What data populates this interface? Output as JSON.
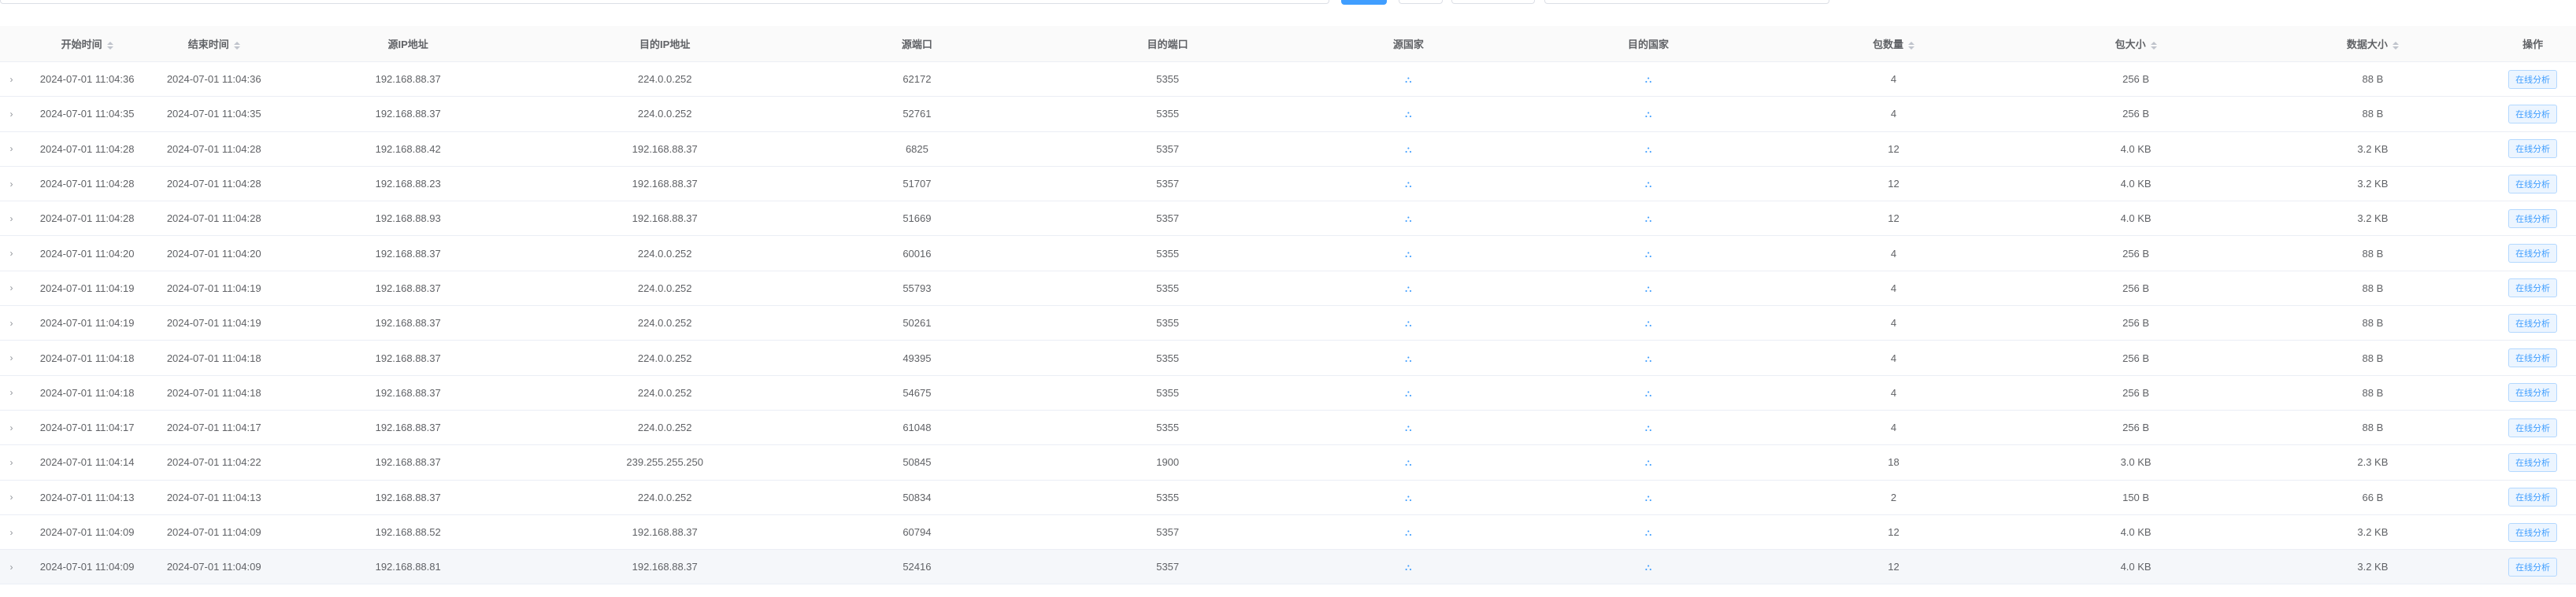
{
  "columns": {
    "start_time": "开始时间",
    "end_time": "结束时间",
    "src_ip": "源IP地址",
    "dst_ip": "目的IP地址",
    "src_port": "源端口",
    "dst_port": "目的端口",
    "src_country": "源国家",
    "dst_country": "目的国家",
    "packets": "包数量",
    "packet_size": "包大小",
    "data_size": "数据大小",
    "action": "操作"
  },
  "action_label": "在线分析",
  "icons": {
    "expand": "chevron-right-icon",
    "country": "network-flag-icon",
    "sort": "sort-caret-icon"
  },
  "colors": {
    "accent": "#409eff",
    "header_bg": "#fafafa",
    "border": "#ebeef5"
  },
  "rows": [
    {
      "start": "2024-07-01 11:04:36",
      "end": "2024-07-01 11:04:36",
      "src_ip": "192.168.88.37",
      "dst_ip": "224.0.0.252",
      "src_port": "62172",
      "dst_port": "5355",
      "packets": "4",
      "psize": "256 B",
      "dsize": "88 B"
    },
    {
      "start": "2024-07-01 11:04:35",
      "end": "2024-07-01 11:04:35",
      "src_ip": "192.168.88.37",
      "dst_ip": "224.0.0.252",
      "src_port": "52761",
      "dst_port": "5355",
      "packets": "4",
      "psize": "256 B",
      "dsize": "88 B"
    },
    {
      "start": "2024-07-01 11:04:28",
      "end": "2024-07-01 11:04:28",
      "src_ip": "192.168.88.42",
      "dst_ip": "192.168.88.37",
      "src_port": "6825",
      "dst_port": "5357",
      "packets": "12",
      "psize": "4.0 KB",
      "dsize": "3.2 KB"
    },
    {
      "start": "2024-07-01 11:04:28",
      "end": "2024-07-01 11:04:28",
      "src_ip": "192.168.88.23",
      "dst_ip": "192.168.88.37",
      "src_port": "51707",
      "dst_port": "5357",
      "packets": "12",
      "psize": "4.0 KB",
      "dsize": "3.2 KB"
    },
    {
      "start": "2024-07-01 11:04:28",
      "end": "2024-07-01 11:04:28",
      "src_ip": "192.168.88.93",
      "dst_ip": "192.168.88.37",
      "src_port": "51669",
      "dst_port": "5357",
      "packets": "12",
      "psize": "4.0 KB",
      "dsize": "3.2 KB"
    },
    {
      "start": "2024-07-01 11:04:20",
      "end": "2024-07-01 11:04:20",
      "src_ip": "192.168.88.37",
      "dst_ip": "224.0.0.252",
      "src_port": "60016",
      "dst_port": "5355",
      "packets": "4",
      "psize": "256 B",
      "dsize": "88 B"
    },
    {
      "start": "2024-07-01 11:04:19",
      "end": "2024-07-01 11:04:19",
      "src_ip": "192.168.88.37",
      "dst_ip": "224.0.0.252",
      "src_port": "55793",
      "dst_port": "5355",
      "packets": "4",
      "psize": "256 B",
      "dsize": "88 B"
    },
    {
      "start": "2024-07-01 11:04:19",
      "end": "2024-07-01 11:04:19",
      "src_ip": "192.168.88.37",
      "dst_ip": "224.0.0.252",
      "src_port": "50261",
      "dst_port": "5355",
      "packets": "4",
      "psize": "256 B",
      "dsize": "88 B"
    },
    {
      "start": "2024-07-01 11:04:18",
      "end": "2024-07-01 11:04:18",
      "src_ip": "192.168.88.37",
      "dst_ip": "224.0.0.252",
      "src_port": "49395",
      "dst_port": "5355",
      "packets": "4",
      "psize": "256 B",
      "dsize": "88 B"
    },
    {
      "start": "2024-07-01 11:04:18",
      "end": "2024-07-01 11:04:18",
      "src_ip": "192.168.88.37",
      "dst_ip": "224.0.0.252",
      "src_port": "54675",
      "dst_port": "5355",
      "packets": "4",
      "psize": "256 B",
      "dsize": "88 B"
    },
    {
      "start": "2024-07-01 11:04:17",
      "end": "2024-07-01 11:04:17",
      "src_ip": "192.168.88.37",
      "dst_ip": "224.0.0.252",
      "src_port": "61048",
      "dst_port": "5355",
      "packets": "4",
      "psize": "256 B",
      "dsize": "88 B"
    },
    {
      "start": "2024-07-01 11:04:14",
      "end": "2024-07-01 11:04:22",
      "src_ip": "192.168.88.37",
      "dst_ip": "239.255.255.250",
      "src_port": "50845",
      "dst_port": "1900",
      "packets": "18",
      "psize": "3.0 KB",
      "dsize": "2.3 KB"
    },
    {
      "start": "2024-07-01 11:04:13",
      "end": "2024-07-01 11:04:13",
      "src_ip": "192.168.88.37",
      "dst_ip": "224.0.0.252",
      "src_port": "50834",
      "dst_port": "5355",
      "packets": "2",
      "psize": "150 B",
      "dsize": "66 B"
    },
    {
      "start": "2024-07-01 11:04:09",
      "end": "2024-07-01 11:04:09",
      "src_ip": "192.168.88.52",
      "dst_ip": "192.168.88.37",
      "src_port": "60794",
      "dst_port": "5357",
      "packets": "12",
      "psize": "4.0 KB",
      "dsize": "3.2 KB"
    },
    {
      "start": "2024-07-01 11:04:09",
      "end": "2024-07-01 11:04:09",
      "src_ip": "192.168.88.81",
      "dst_ip": "192.168.88.37",
      "src_port": "52416",
      "dst_port": "5357",
      "packets": "12",
      "psize": "4.0 KB",
      "dsize": "3.2 KB"
    }
  ]
}
